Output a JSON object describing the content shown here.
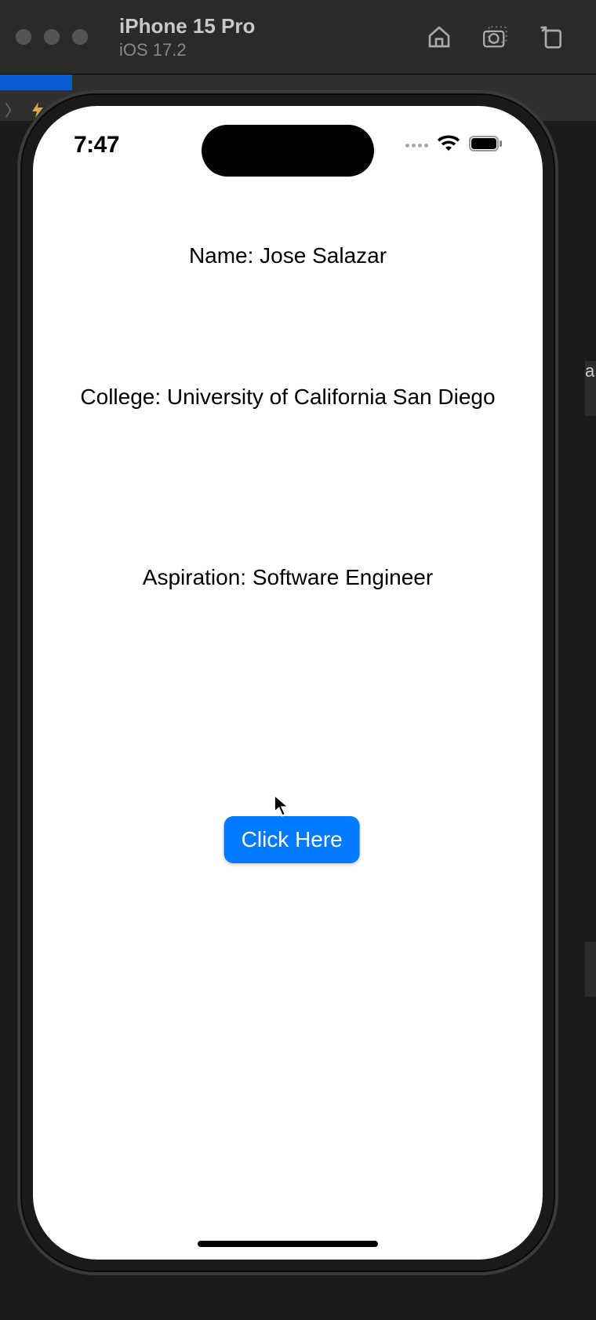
{
  "simulator": {
    "device_title": "iPhone 15 Pro",
    "os_subtitle": "iOS 17.2"
  },
  "status_bar": {
    "time": "7:47"
  },
  "app": {
    "name_label": "Name: Jose Salazar",
    "college_label": "College: University of California San Diego",
    "aspiration_label": "Aspiration: Software Engineer",
    "button_label": "Click Here"
  }
}
